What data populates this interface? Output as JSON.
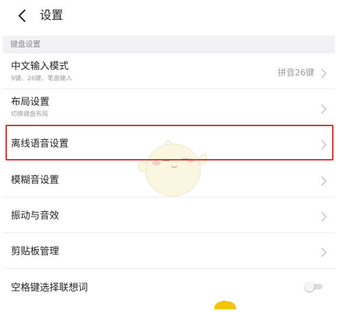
{
  "header": {
    "back_icon": "chevron-left-icon",
    "title": "设置"
  },
  "section": {
    "title": "键盘设置"
  },
  "rows": [
    {
      "title": "中文输入模式",
      "subtitle": "9键、26键、笔画输入",
      "value": "拼音26键",
      "icon": "chevron-right-icon"
    },
    {
      "title": "布局设置",
      "subtitle": "切换键盘布局",
      "icon": "chevron-right-icon"
    },
    {
      "title": "离线语音设置",
      "icon": "chevron-right-icon",
      "highlighted": true
    },
    {
      "title": "模糊音设置",
      "icon": "chevron-right-icon"
    },
    {
      "title": "振动与音效",
      "icon": "chevron-right-icon"
    },
    {
      "title": "剪贴板管理",
      "icon": "chevron-right-icon"
    },
    {
      "title": "空格键选择联想词",
      "toggle": false
    }
  ],
  "colors": {
    "highlight_border": "#d6302e",
    "section_bg": "#f2f2f5",
    "secondary_text": "#9a9a9a",
    "mascot_body": "#f6f0c8",
    "mascot_peek": "#f5c400"
  },
  "decorations": {
    "mascot": "chick-mascot-watermark",
    "mascot_peek": "chick-mascot-icon"
  }
}
